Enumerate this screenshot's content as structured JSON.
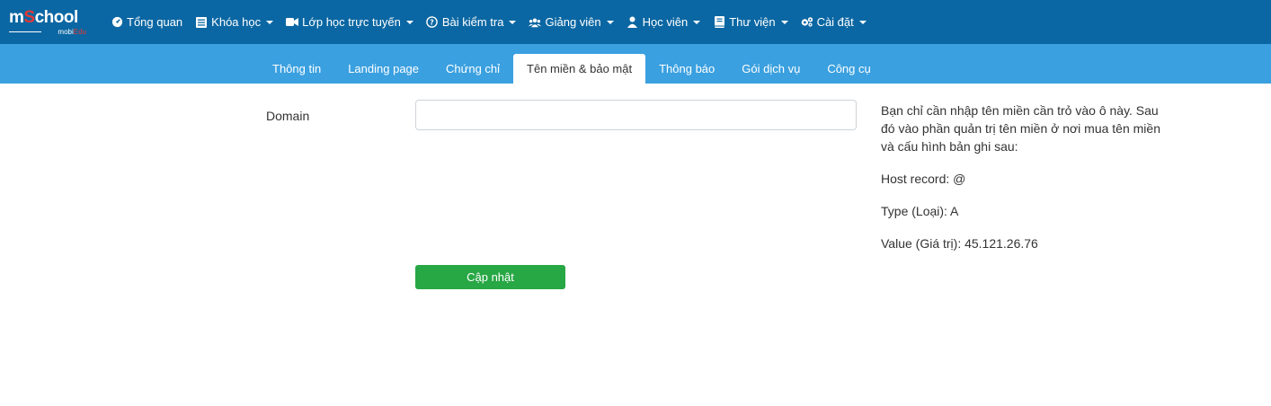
{
  "brand": {
    "logo_prefix": "m",
    "logo_accent": "S",
    "logo_suffix": "chool",
    "sub_prefix": "mobi",
    "sub_accent": "Edu"
  },
  "topnav": {
    "items": [
      {
        "label": "Tổng quan",
        "icon": "dashboard-icon",
        "dropdown": false
      },
      {
        "label": "Khóa học",
        "icon": "list-icon",
        "dropdown": true
      },
      {
        "label": "Lớp học trực tuyến",
        "icon": "video-camera-icon",
        "dropdown": true
      },
      {
        "label": "Bài kiểm tra",
        "icon": "question-circle-icon",
        "dropdown": true
      },
      {
        "label": "Giảng viên",
        "icon": "users-icon",
        "dropdown": true
      },
      {
        "label": "Học viên",
        "icon": "user-icon",
        "dropdown": true
      },
      {
        "label": "Thư viện",
        "icon": "book-icon",
        "dropdown": true
      },
      {
        "label": "Cài đặt",
        "icon": "gears-icon",
        "dropdown": true
      }
    ]
  },
  "tabs": [
    {
      "label": "Thông tin",
      "active": false
    },
    {
      "label": "Landing page",
      "active": false
    },
    {
      "label": "Chứng chỉ",
      "active": false
    },
    {
      "label": "Tên miền & bảo mật",
      "active": true
    },
    {
      "label": "Thông báo",
      "active": false
    },
    {
      "label": "Gói dịch vụ",
      "active": false
    },
    {
      "label": "Công cụ",
      "active": false
    }
  ],
  "form": {
    "domain_label": "Domain",
    "domain_value": "",
    "domain_placeholder": "",
    "submit_label": "Cập nhật"
  },
  "help": {
    "intro": "Bạn chỉ cần nhập tên miền cần trỏ vào ô này. Sau đó vào phần quản trị tên miền ở nơi mua tên miền và cấu hình bản ghi sau:",
    "host_record": "Host record: @",
    "type": "Type (Loại): A",
    "value": "Value (Giá trị): 45.121.26.76"
  },
  "colors": {
    "topbar": "#0b67a3",
    "subbar": "#3aa0e0",
    "submit": "#28a745",
    "logo_accent": "#e53935"
  }
}
